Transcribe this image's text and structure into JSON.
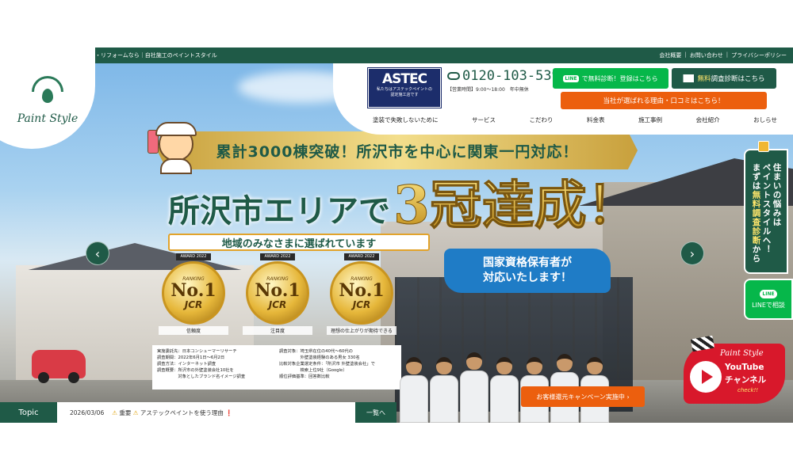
{
  "topbar": {
    "tagline": "所沢市を中心に関東一円で外壁塗装・リフォームなら｜自社施工のペイントスタイル",
    "links": [
      "会社概要",
      "お問い合わせ",
      "プライバシーポリシー"
    ]
  },
  "logo": {
    "name": "Paint Style",
    "small": "PAINT STYLE"
  },
  "astec": {
    "name": "ASTEC",
    "sub1": "私たちはアステックペイントの",
    "sub2": "認定施工店です"
  },
  "tel": {
    "number": "0120-103-539",
    "hours": "【営業時間】9:00～18:00　年中無休"
  },
  "buttons": {
    "line_chip": "LINE",
    "line_label": "で無料診断！登録はこちら",
    "mail_hl": "無料",
    "mail_label": "調査診断はこちら",
    "reason": "当社が選ばれる理由・口コミはこちら！",
    "campaign": "お客様還元キャンペーン実施中 ›"
  },
  "nav": [
    "塗装で失敗しないために",
    "サービス",
    "こだわり",
    "料金表",
    "施工事例",
    "会社紹介",
    "おしらせ"
  ],
  "hero": {
    "banner": "累計3000棟突破！所沢市を中心に関東一円対応！",
    "title_area": "所沢市エリアで",
    "title_big": "3冠達成！",
    "regional": "地域のみなさまに選ばれています",
    "license_l1": "国家資格保有者が",
    "license_l2": "対応いたします！"
  },
  "awards": [
    {
      "year": "AWARD 2022",
      "ranking": "RANKING",
      "no1": "No.1",
      "jcr": "JCR",
      "label": "信頼度"
    },
    {
      "year": "AWARD 2022",
      "ranking": "RANKING",
      "no1": "No.1",
      "jcr": "JCR",
      "label": "注目度"
    },
    {
      "year": "AWARD 2022",
      "ranking": "RANKING",
      "no1": "No.1",
      "jcr": "JCR",
      "label": "理想の仕上がりが期待できる"
    }
  ],
  "survey": {
    "left": [
      "実施委託先：日本コンシューマーリサーチ",
      "調査期間：2022年6月1日～6月2日",
      "調査方法：インターネット調査",
      "調査概要：所沢市の外壁塗装会社10社を",
      "　　　　　対象としたブランド名イメージ調査"
    ],
    "right": [
      "調査対象：埼玉県在住の40代～60代の",
      "　　　　　外壁塗装経験のある男女 330名",
      "比較対象企業選定条件：「所沢市 外壁塗装会社」で",
      "　　　　　検索上位9社（Google）",
      "順位評価基準：回答数比較"
    ]
  },
  "side": {
    "consult_l1": "住まいの悩みは",
    "consult_l2": "ペイントスタイルへ！",
    "consult_l3a": "まずは",
    "consult_l3b": "無料調査診断",
    "consult_l3c": "から",
    "line_bubble": "LINE",
    "line_text": "LINEで相談"
  },
  "youtube": {
    "l1": "Paint Style",
    "l2": "YouTube",
    "l3": "チャンネル",
    "l4": "check!!"
  },
  "topic": {
    "label": "Topic",
    "date": "2026/03/06",
    "badge": "重要",
    "text": "アステックペイントを使う理由",
    "more": "一覧へ"
  },
  "arrows": {
    "prev": "‹",
    "next": "›"
  },
  "colors": {
    "brand_green": "#1f5a47",
    "accent_orange": "#ec5f0e",
    "line_green": "#06b74a",
    "youtube_red": "#d8182b"
  }
}
